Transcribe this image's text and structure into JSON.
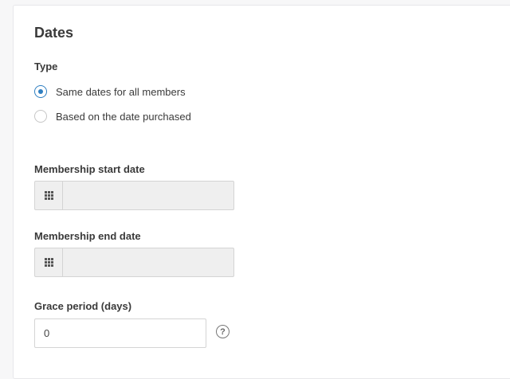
{
  "section": {
    "title": "Dates"
  },
  "type": {
    "label": "Type",
    "options": [
      {
        "label": "Same dates for all members",
        "selected": true
      },
      {
        "label": "Based on the date purchased",
        "selected": false
      }
    ]
  },
  "start_date": {
    "label": "Membership start date",
    "value": "",
    "icon": "calendar-grid-icon"
  },
  "end_date": {
    "label": "Membership end date",
    "value": "",
    "icon": "calendar-grid-icon"
  },
  "grace_period": {
    "label": "Grace period (days)",
    "value": "0",
    "help_icon": "?"
  },
  "colors": {
    "accent": "#2f7fc1",
    "disabled_field": "#efefef"
  }
}
